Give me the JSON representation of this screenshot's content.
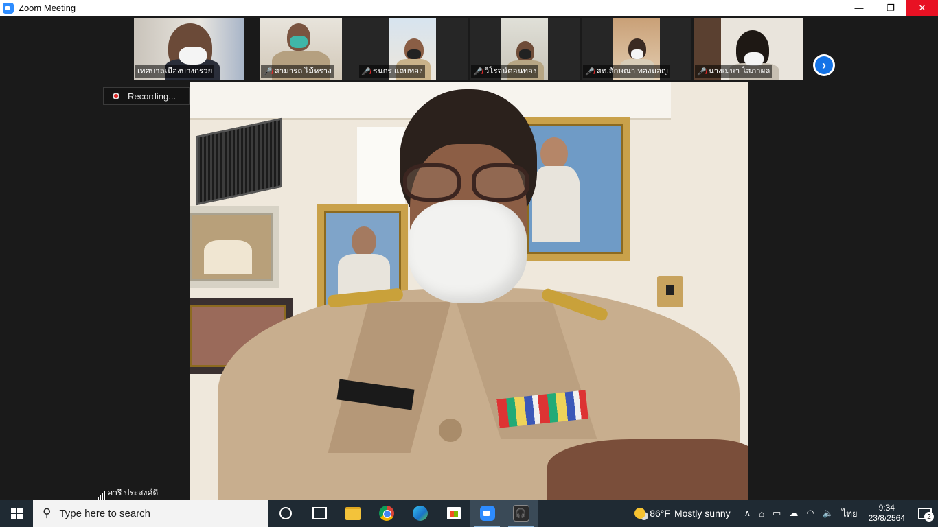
{
  "window": {
    "title": "Zoom Meeting",
    "minimize_glyph": "—",
    "restore_glyph": "❐",
    "close_glyph": "✕"
  },
  "gallery": {
    "participants": [
      {
        "name": "เทศบาลเมืองบางกรวย",
        "muted": false
      },
      {
        "name": "สามารถ ไม้หราง",
        "muted": true
      },
      {
        "name": "ธนกร แถบทอง",
        "muted": true
      },
      {
        "name": "วิโรจน์ดอนทอง",
        "muted": true
      },
      {
        "name": "สท.ลักษณา ทองมอญ",
        "muted": true
      },
      {
        "name": "นางเมษา โสภาผล",
        "muted": true
      }
    ],
    "next_page_icon": "chevron-right-icon"
  },
  "recording": {
    "label": "Recording..."
  },
  "active_speaker": {
    "name": "อารี ประสงค์ดี"
  },
  "taskbar": {
    "search_placeholder": "Type here to search",
    "weather": {
      "temp": "86°F",
      "condition": "Mostly sunny"
    },
    "language": "ไทย",
    "time": "9:34",
    "date": "23/8/2564",
    "notification_count": "2"
  },
  "colors": {
    "zoom_blue": "#2d8cff",
    "close_red": "#e81123",
    "muted_red": "#e02828",
    "taskbar": "#1f2a33"
  }
}
